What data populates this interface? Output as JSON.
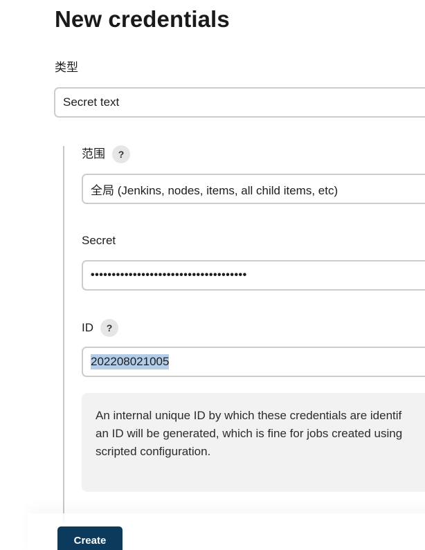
{
  "page": {
    "title": "New credentials"
  },
  "kind": {
    "label": "类型",
    "value": "Secret text"
  },
  "scope": {
    "label": "范围",
    "help": "?",
    "value": "全局 (Jenkins, nodes, items, all child items, etc)"
  },
  "secret": {
    "label": "Secret",
    "masked_value": "•••••••••••••••••••••••••••••••••••••"
  },
  "id_field": {
    "label": "ID",
    "help": "?",
    "value": "202208021005"
  },
  "id_help": {
    "line1": "An internal unique ID by which these credentials are identif",
    "line2": "an ID will be generated, which is fine for jobs created using",
    "line3": "scripted configuration."
  },
  "actions": {
    "create_label": "Create"
  },
  "colors": {
    "primary_button": "#0b3a5c",
    "selection": "#b3cde9",
    "input_border": "#c8cdd1",
    "help_panel_bg": "#f2f2f2"
  }
}
